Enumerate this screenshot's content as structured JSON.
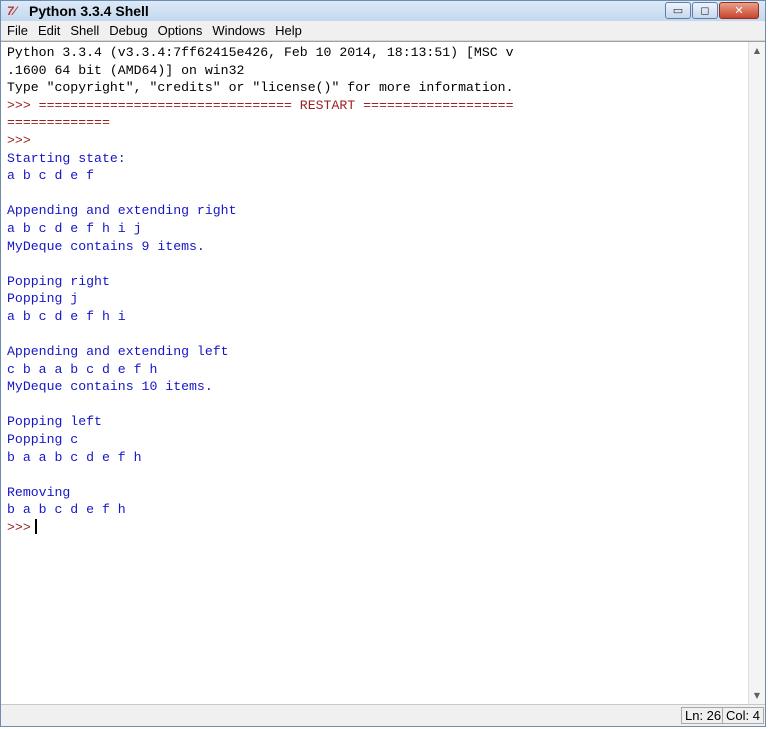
{
  "window": {
    "title": "Python 3.3.4 Shell",
    "icon": "python-idle-icon",
    "controls": [
      "minimize",
      "maximize",
      "close"
    ]
  },
  "menu": [
    "File",
    "Edit",
    "Shell",
    "Debug",
    "Options",
    "Windows",
    "Help"
  ],
  "shell": {
    "lines": [
      {
        "kind": "hdr",
        "text": "Python 3.3.4 (v3.3.4:7ff62415e426, Feb 10 2014, 18:13:51) [MSC v"
      },
      {
        "kind": "hdr",
        "text": ".1600 64 bit (AMD64)] on win32"
      },
      {
        "kind": "hdr",
        "text": "Type \"copyright\", \"credits\" or \"license()\" for more information."
      },
      {
        "kind": "prompt",
        "text": ">>> ================================ RESTART ==================="
      },
      {
        "kind": "prompt",
        "text": "============="
      },
      {
        "kind": "prompt",
        "text": ">>>"
      },
      {
        "kind": "out",
        "text": "Starting state:"
      },
      {
        "kind": "out",
        "text": "a b c d e f"
      },
      {
        "kind": "out",
        "text": ""
      },
      {
        "kind": "out",
        "text": "Appending and extending right"
      },
      {
        "kind": "out",
        "text": "a b c d e f h i j"
      },
      {
        "kind": "out",
        "text": "MyDeque contains 9 items."
      },
      {
        "kind": "out",
        "text": ""
      },
      {
        "kind": "out",
        "text": "Popping right"
      },
      {
        "kind": "out",
        "text": "Popping j"
      },
      {
        "kind": "out",
        "text": "a b c d e f h i"
      },
      {
        "kind": "out",
        "text": ""
      },
      {
        "kind": "out",
        "text": "Appending and extending left"
      },
      {
        "kind": "out",
        "text": "c b a a b c d e f h"
      },
      {
        "kind": "out",
        "text": "MyDeque contains 10 items."
      },
      {
        "kind": "out",
        "text": ""
      },
      {
        "kind": "out",
        "text": "Popping left"
      },
      {
        "kind": "out",
        "text": "Popping c"
      },
      {
        "kind": "out",
        "text": "b a a b c d e f h"
      },
      {
        "kind": "out",
        "text": ""
      },
      {
        "kind": "out",
        "text": "Removing"
      },
      {
        "kind": "out",
        "text": "b a b c d e f h"
      }
    ],
    "final_prompt": ">>>"
  },
  "status": {
    "ln": "Ln: 26",
    "col": "Col: 4"
  },
  "colors": {
    "prompt": "#9a1f1f",
    "output": "#1515c8",
    "header": "#000000"
  }
}
